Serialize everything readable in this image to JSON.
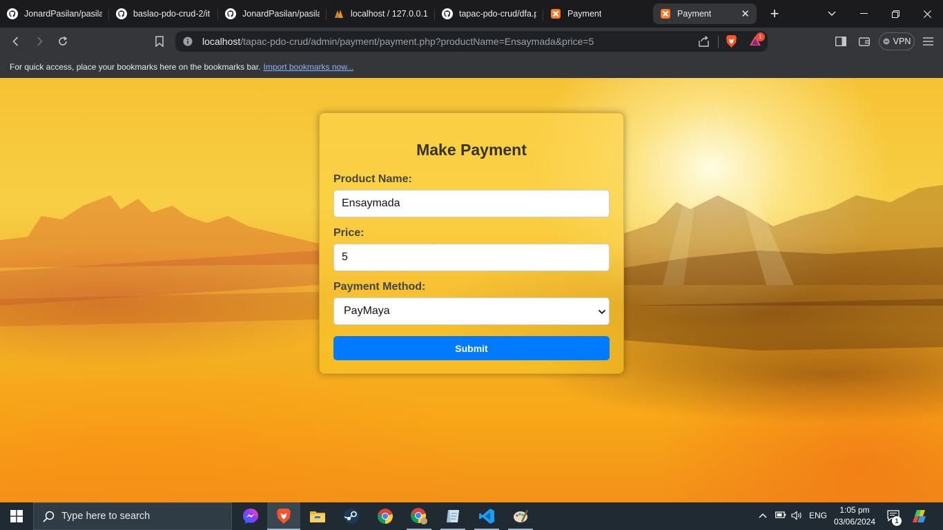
{
  "browser": {
    "tabs": [
      {
        "title": "JonardPasilan/pasilan",
        "icon": "github-icon",
        "active": false
      },
      {
        "title": "baslao-pdo-crud-2/it",
        "icon": "github-icon",
        "active": false
      },
      {
        "title": "JonardPasilan/pasilan",
        "icon": "github-icon",
        "active": false
      },
      {
        "title": "localhost / 127.0.0.1 /",
        "icon": "phpmyadmin-icon",
        "active": false
      },
      {
        "title": "tapac-pdo-crud/dfa.p",
        "icon": "github-icon",
        "active": false
      },
      {
        "title": "Payment",
        "icon": "xampp-icon",
        "active": false
      },
      {
        "title": "Payment",
        "icon": "xampp-icon",
        "active": true
      }
    ],
    "address": {
      "host": "localhost",
      "path": "/tapac-pdo-crud/admin/payment/payment.php?productName=Ensaymada&price=5"
    },
    "brave_badge_count": "1",
    "vpn_label": "VPN",
    "bookmarks_bar": {
      "message": "For quick access, place your bookmarks here on the bookmarks bar.",
      "link": "Import bookmarks now..."
    }
  },
  "form": {
    "title": "Make Payment",
    "product_label": "Product Name:",
    "product_value": "Ensaymada",
    "price_label": "Price:",
    "price_value": "5",
    "method_label": "Payment Method:",
    "method_selected": "PayMaya",
    "submit_label": "Submit"
  },
  "taskbar": {
    "search_placeholder": "Type here to search",
    "language": "ENG",
    "time": "1:05 pm",
    "date": "03/06/2024",
    "notification_count": "1"
  },
  "colors": {
    "accent_button": "#007bff",
    "tab_bar": "#1b1b1d",
    "toolbar": "#35363a",
    "taskbar": "#1f2a33"
  }
}
